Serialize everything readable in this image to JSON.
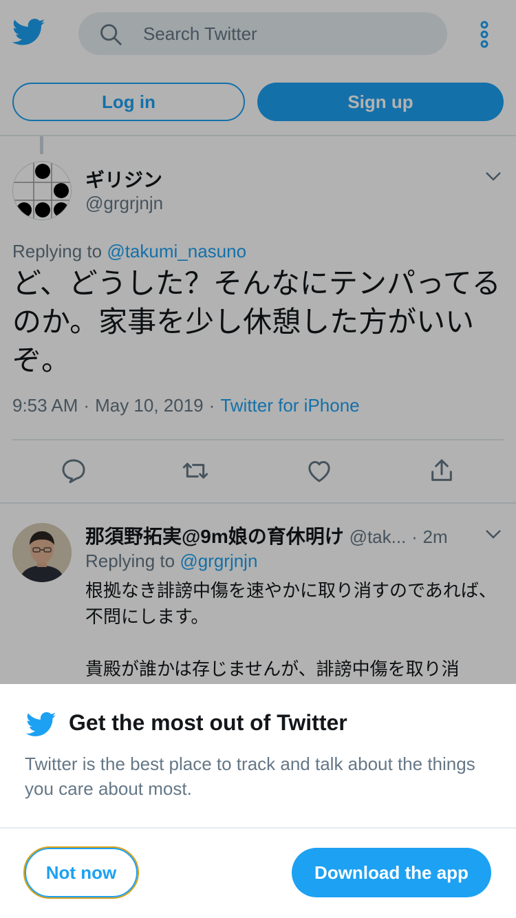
{
  "colors": {
    "brand": "#1da1f2",
    "text": "#14171a",
    "muted": "#657786",
    "focus_outline": "#d4a017"
  },
  "header": {
    "search_placeholder": "Search Twitter",
    "login_label": "Log in",
    "signup_label": "Sign up"
  },
  "tweet": {
    "name": "ギリジン",
    "handle": "@grgrjnjn",
    "replying_prefix": "Replying to",
    "replying_to": "@takumi_nasuno",
    "text": "ど、どうした？そんなにテンパってるのか。家事を少し休憩した方がいいぞ。",
    "time": "9:53 AM",
    "date": "May 10, 2019",
    "source": "Twitter for iPhone",
    "actions": [
      "reply-icon",
      "retweet-icon",
      "like-icon",
      "share-icon"
    ]
  },
  "reply": {
    "name": "那須野拓実@9m娘の育休明け",
    "handle": "@tak...",
    "age": "2m",
    "replying_prefix": "Replying to",
    "replying_to": "@grgrjnjn",
    "paragraph1": "根拠なき誹謗中傷を速やかに取り消すのであれば、不問にします。",
    "paragraph2": "貴殿が誰かは存じませんが、誹謗中傷を取り消"
  },
  "sheet": {
    "title": "Get the most out of Twitter",
    "description": "Twitter is the best place to track and talk about the things you care about most.",
    "not_now_label": "Not now",
    "download_label": "Download the app"
  }
}
